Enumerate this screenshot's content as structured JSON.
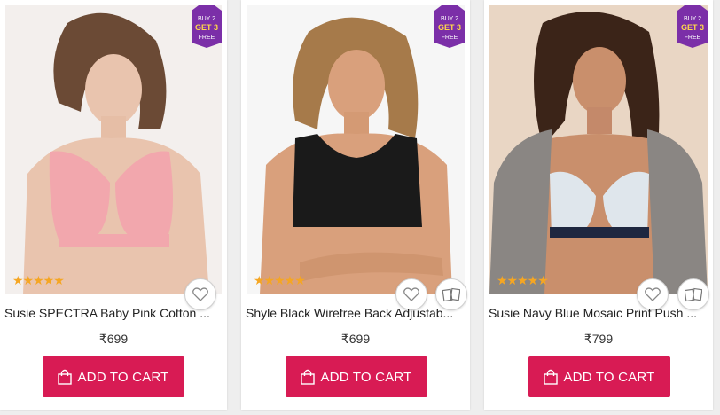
{
  "offer_badge": {
    "line1": "BUY 2",
    "line2": "GET 3",
    "line3": "FREE",
    "color": "#7b2fa8"
  },
  "accent_color": "#d81b54",
  "products": [
    {
      "title": "Susie SPECTRA Baby Pink Cotton ...",
      "price": "₹699",
      "rating_stars": "★★★★★",
      "wishlist_icon": "heart-icon",
      "cart_label": "ADD TO CART",
      "cart_icon": "shopping-bag-icon"
    },
    {
      "title": "Shyle Black Wirefree Back Adjustab...",
      "price": "₹699",
      "rating_stars": "★★★★★",
      "wishlist_icon": "heart-icon",
      "compare_icon": "compare-icon",
      "cart_label": "ADD TO CART",
      "cart_icon": "shopping-bag-icon"
    },
    {
      "title": "Susie Navy Blue Mosaic Print Push ...",
      "price": "₹799",
      "rating_stars": "★★★★★",
      "wishlist_icon": "heart-icon",
      "compare_icon": "compare-icon",
      "cart_label": "ADD TO CART",
      "cart_icon": "shopping-bag-icon"
    }
  ]
}
